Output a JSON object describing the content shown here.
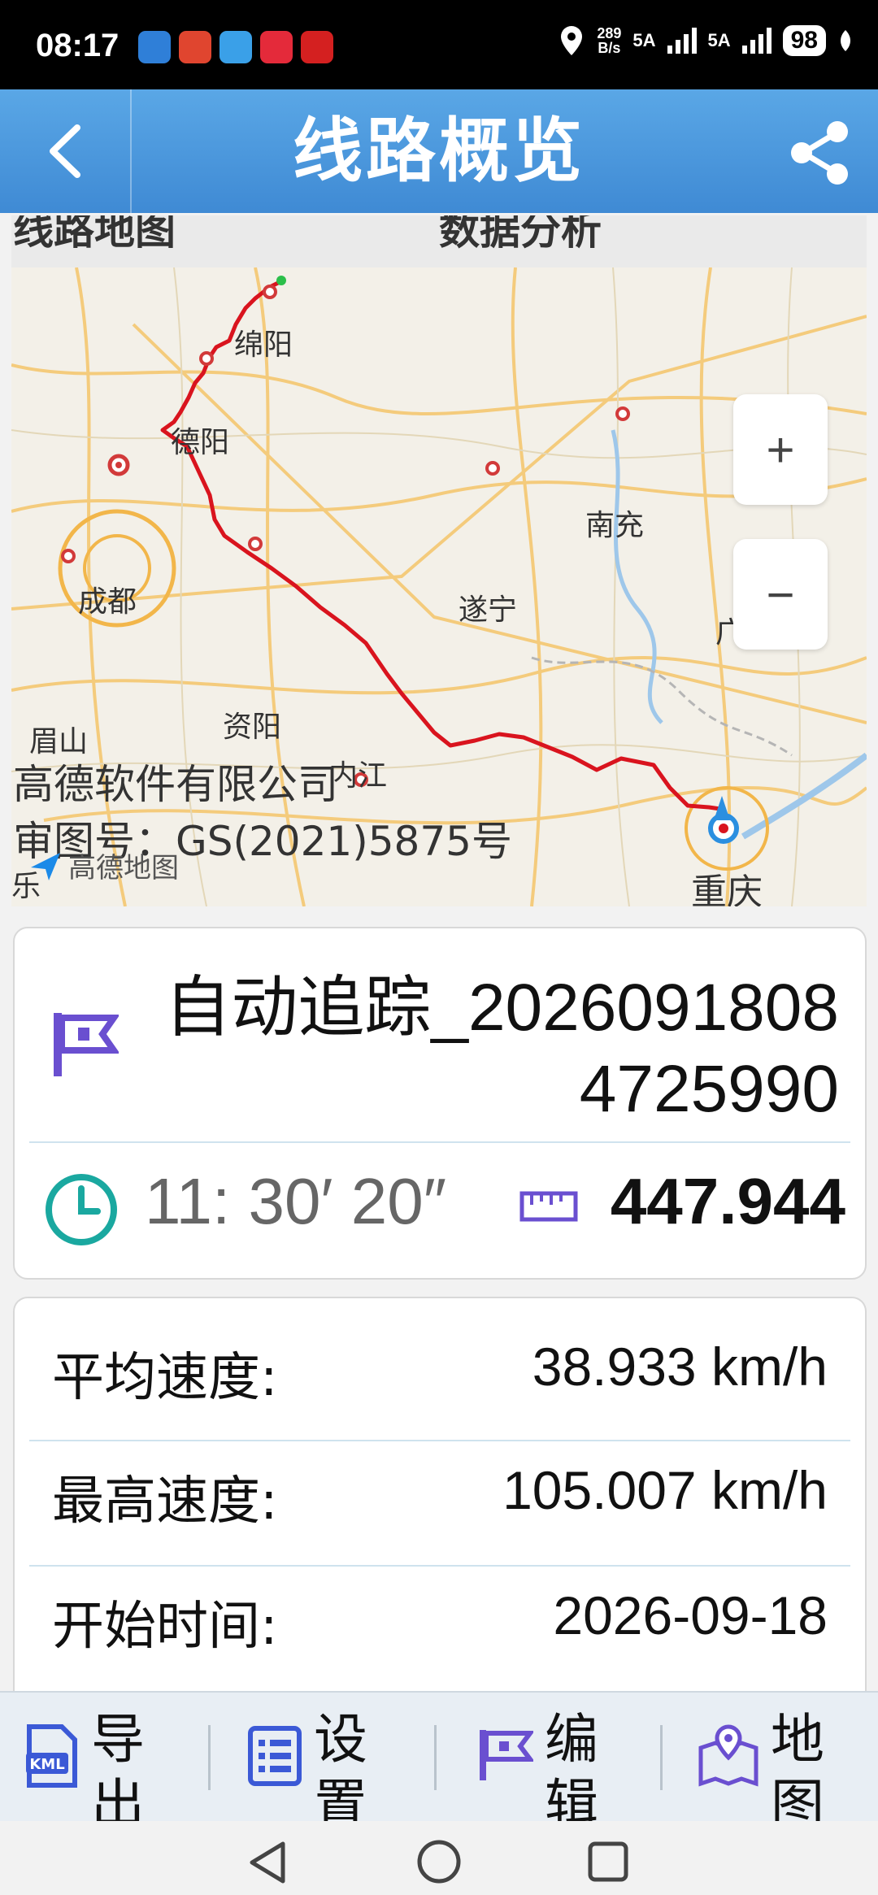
{
  "status_bar": {
    "time": "08:17",
    "net_rate_top": "289",
    "net_rate_bottom": "B/s",
    "signal1": "5A",
    "signal2": "5A",
    "battery": "98"
  },
  "header": {
    "title": "线路概览",
    "back_icon": "chevron-left-icon",
    "share_icon": "share-icon"
  },
  "map": {
    "tab_route_map": "线路地图",
    "tab_data_analysis": "数据分析",
    "zoom_in": "+",
    "zoom_out": "−",
    "cities": {
      "mianyang": "绵阳",
      "deyang": "德阳",
      "nanchong": "南充",
      "chengdu": "成都",
      "suining": "遂宁",
      "guang": "广",
      "meishan": "眉山",
      "ziyang": "资阳",
      "neijiang": "内江",
      "chongqing": "重庆",
      "le": "乐"
    },
    "copyright_line1": "高德软件有限公司",
    "copyright_line2": "审图号：GS(2021)5875号",
    "logo_text": "高德地图"
  },
  "track": {
    "name": "自动追踪_20260918084725990",
    "duration": "11: 30′ 20″",
    "distance": "447.944"
  },
  "stats": [
    {
      "label": "平均速度:",
      "value": "38.933 km/h"
    },
    {
      "label": "最高速度:",
      "value": "105.007 km/h"
    },
    {
      "label": "开始时间:",
      "value": "2026-09-18"
    }
  ],
  "toolbar": [
    {
      "label": "导出",
      "icon": "kml-file-icon"
    },
    {
      "label": "设置",
      "icon": "list-icon"
    },
    {
      "label": "编辑",
      "icon": "flag-icon"
    },
    {
      "label": "地图",
      "icon": "map-icon"
    }
  ],
  "colors": {
    "header_blue": "#4a96dc",
    "route_red": "#d9141e",
    "icon_purple": "#6a4fd0",
    "clock_teal": "#1aa8a0"
  }
}
